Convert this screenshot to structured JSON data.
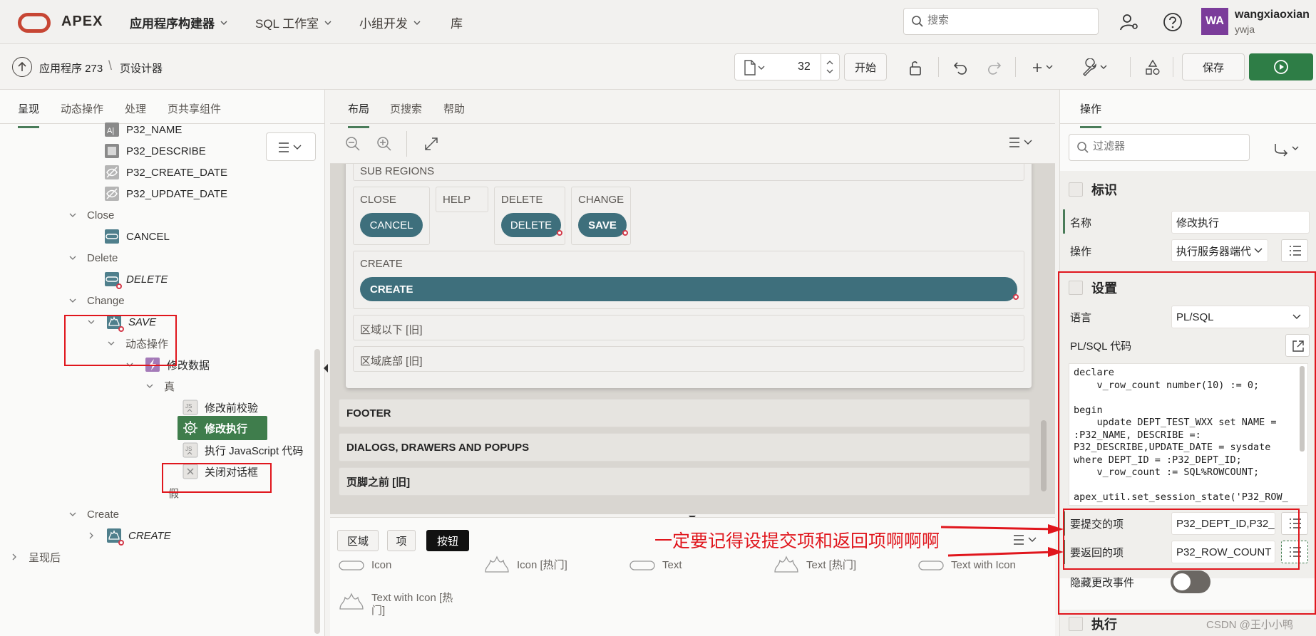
{
  "topbar": {
    "brand": "APEX",
    "nav": [
      {
        "label": "应用程序构建器",
        "active": true
      },
      {
        "label": "SQL 工作室",
        "active": false
      },
      {
        "label": "小组开发",
        "active": false
      },
      {
        "label": "库",
        "active": false
      }
    ],
    "search_placeholder": "搜索",
    "avatar_initials": "WA",
    "user_name": "wangxiaoxian",
    "workspace": "ywja"
  },
  "toolbar": {
    "app_crumb": "应用程序 273",
    "page_crumb": "页设计器",
    "page_number": "32",
    "go_label": "开始",
    "save_label": "保存"
  },
  "left_panel": {
    "tabs": [
      "呈现",
      "动态操作",
      "处理",
      "页共享组件"
    ],
    "tree": [
      {
        "label": "P32_NAME",
        "icon": "text-field-icon"
      },
      {
        "label": "P32_DESCRIBE",
        "icon": "textarea-icon"
      },
      {
        "label": "P32_CREATE_DATE",
        "icon": "hidden-icon"
      },
      {
        "label": "P32_UPDATE_DATE",
        "icon": "hidden-icon"
      },
      {
        "label": "Close"
      },
      {
        "label": "CANCEL",
        "icon": "button-icon"
      },
      {
        "label": "Delete"
      },
      {
        "label": "DELETE",
        "icon": "button-icon"
      },
      {
        "label": "Change"
      },
      {
        "label": "SAVE",
        "icon": "hot-button-icon"
      },
      {
        "label": "动态操作"
      },
      {
        "label": "修改数据",
        "icon": "lightning-icon"
      },
      {
        "label": "真"
      },
      {
        "label": "修改前校验",
        "icon": "js-icon"
      },
      {
        "label": "修改执行",
        "icon": "gear-icon",
        "selected": true
      },
      {
        "label": "执行 JavaScript 代码",
        "icon": "js-icon"
      },
      {
        "label": "关闭对话框",
        "icon": "close-dialog-icon"
      },
      {
        "label": "假"
      },
      {
        "label": "Create"
      },
      {
        "label": "CREATE",
        "icon": "hot-button-icon"
      },
      {
        "label": "呈现后"
      }
    ]
  },
  "center": {
    "tabs": [
      "布局",
      "页搜索",
      "帮助"
    ],
    "sub_regions_label": "SUB REGIONS",
    "slots": [
      {
        "label": "CLOSE",
        "button": "CANCEL"
      },
      {
        "label": "HELP",
        "button": ""
      },
      {
        "label": "DELETE",
        "button": "DELETE"
      },
      {
        "label": "CHANGE",
        "button": "SAVE"
      }
    ],
    "create_slot": {
      "label": "CREATE",
      "button": "CREATE"
    },
    "below_region": "区域以下 [旧]",
    "region_bottom": "区域底部 [旧]",
    "regions": [
      "FOOTER",
      "DIALOGS, DRAWERS AND POPUPS",
      "页脚之前 [旧]"
    ],
    "gallery_tabs": [
      {
        "label": "区域",
        "active": false
      },
      {
        "label": "项",
        "active": false
      },
      {
        "label": "按钮",
        "active": true
      }
    ],
    "gallery_items": [
      "Icon",
      "Icon [热门]",
      "Text",
      "Text [热门]",
      "Text with Icon",
      "Text with Icon [热门]"
    ]
  },
  "right_panel": {
    "tab": "操作",
    "filter_placeholder": "过滤器",
    "identification": {
      "title": "标识",
      "name_label": "名称",
      "name_value": "修改执行",
      "action_label": "操作",
      "action_value": "执行服务器端代"
    },
    "settings": {
      "title": "设置",
      "language_label": "语言",
      "language_value": "PL/SQL",
      "code_label": "PL/SQL 代码",
      "code": "declare\n    v_row_count number(10) := 0;\n\nbegin\n    update DEPT_TEST_WXX set NAME =\n:P32_NAME, DESCRIBE =:\nP32_DESCRIBE,UPDATE_DATE = sysdate\nwhere DEPT_ID = :P32_DEPT_ID;\n    v_row_count := SQL%ROWCOUNT;\n\napex_util.set_session_state('P32_ROW_",
      "submit_label": "要提交的项",
      "submit_value": "P32_DEPT_ID,P32_N",
      "return_label": "要返回的项",
      "return_value": "P32_ROW_COUNT",
      "suppress_label": "隐藏更改事件"
    },
    "execution_title": "执行"
  },
  "annotation": {
    "text": "一定要记得设提交项和返回项啊啊啊",
    "color": "#e0161d"
  },
  "watermark": "CSDN @王小小鸭"
}
